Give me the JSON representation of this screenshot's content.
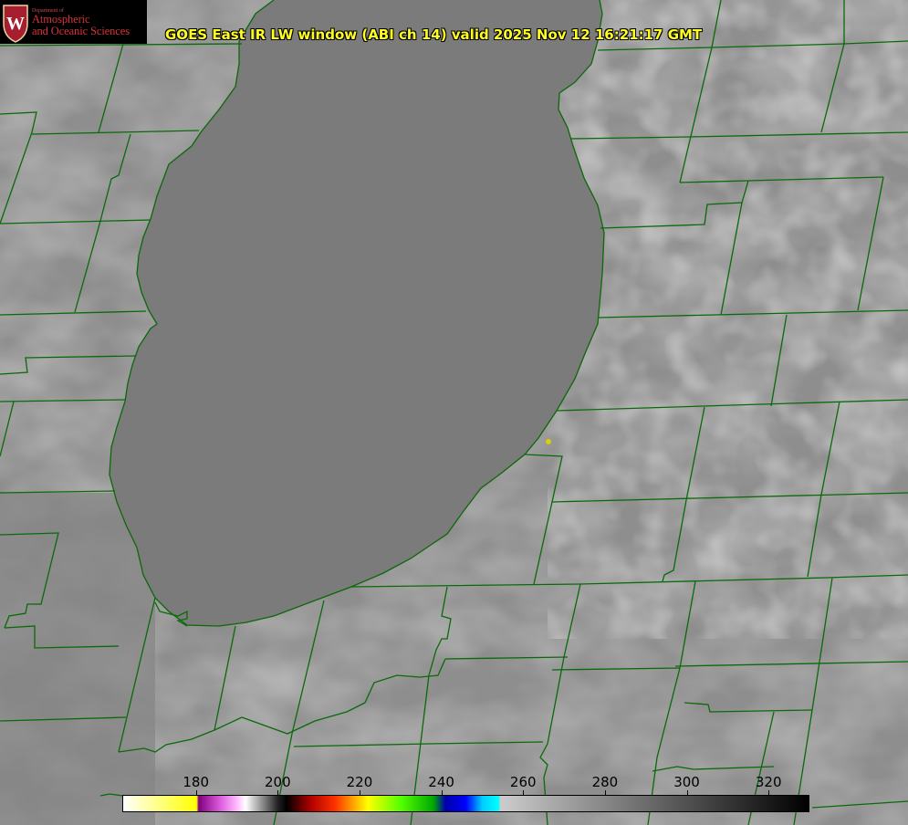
{
  "title": "GOES East IR LW window (ABI ch 14) valid 2025 Nov 12 16:21:17 GMT",
  "logo": {
    "department": "Department of",
    "line1": "Atmospheric",
    "line2": "and Oceanic Sciences",
    "shield_letter": "W",
    "colors": {
      "background": "#000000",
      "text": "#d8323a",
      "shield": "#a61e2f"
    }
  },
  "colorbar": {
    "range": [
      162,
      330
    ],
    "ticks": [
      180,
      200,
      220,
      240,
      260,
      280,
      300,
      320
    ],
    "tick_labels": [
      "180",
      "200",
      "220",
      "240",
      "260",
      "280",
      "300",
      "320"
    ],
    "stops": [
      {
        "t": 162,
        "color": "#ffffff"
      },
      {
        "t": 180,
        "color": "#ffff00"
      },
      {
        "t": 180.5,
        "color": "#800080"
      },
      {
        "t": 186,
        "color": "#e060e0"
      },
      {
        "t": 190,
        "color": "#ffc0ff"
      },
      {
        "t": 192,
        "color": "#ffffff"
      },
      {
        "t": 200,
        "color": "#202020"
      },
      {
        "t": 202,
        "color": "#000000"
      },
      {
        "t": 208,
        "color": "#b00000"
      },
      {
        "t": 214,
        "color": "#ff3300"
      },
      {
        "t": 218,
        "color": "#ff9900"
      },
      {
        "t": 222,
        "color": "#ffff00"
      },
      {
        "t": 230,
        "color": "#55ff00"
      },
      {
        "t": 238,
        "color": "#00aa00"
      },
      {
        "t": 241,
        "color": "#0000aa"
      },
      {
        "t": 246,
        "color": "#0000ff"
      },
      {
        "t": 250,
        "color": "#00ccff"
      },
      {
        "t": 254,
        "color": "#00ffff"
      },
      {
        "t": 254.5,
        "color": "#cccccc"
      },
      {
        "t": 330,
        "color": "#000000"
      }
    ]
  },
  "map": {
    "background_color": "#8e8e8e",
    "lake_color": "#7b7b7b",
    "boundary_color": "#0a6a0a",
    "coastline_color": "#ff2a2a",
    "station_marker_color": "#d8d000"
  }
}
